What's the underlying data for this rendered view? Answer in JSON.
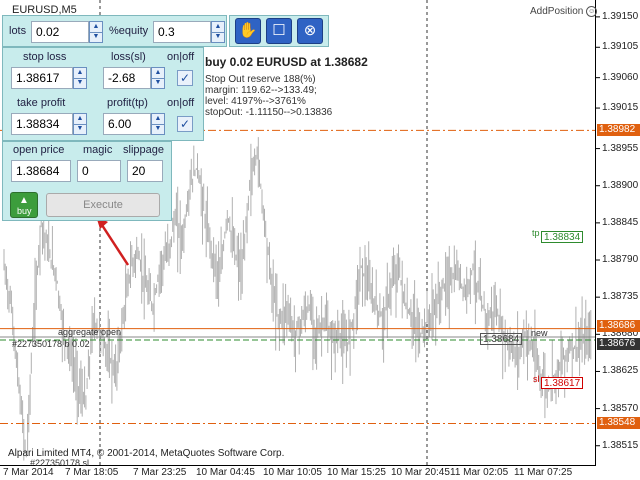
{
  "window": {
    "title": "EURUSD,M5"
  },
  "addposition": {
    "label": "AddPosition",
    "icon": "smiley-icon"
  },
  "panel": {
    "lots": {
      "label": "lots",
      "value": "0.02"
    },
    "equity": {
      "label": "%equity",
      "value": "0.3"
    },
    "toolbar": {
      "hand_icon": "hand-icon",
      "square_icon": "square-icon",
      "close_icon": "close-icon"
    },
    "stop_loss": {
      "label": "stop loss",
      "value": "1.38617"
    },
    "loss_sl": {
      "label": "loss(sl)",
      "value": "-2.68"
    },
    "onoff1": {
      "label": "on|off",
      "checked": true
    },
    "take_profit": {
      "label": "take profit",
      "value": "1.38834"
    },
    "profit_tp": {
      "label": "profit(tp)",
      "value": "6.00"
    },
    "onoff2": {
      "label": "on|off",
      "checked": true
    },
    "open_price": {
      "label": "open price",
      "value": "1.38684"
    },
    "magic": {
      "label": "magic",
      "value": "0"
    },
    "slippage": {
      "label": "slippage",
      "value": "20"
    },
    "buy_label": "buy",
    "execute_label": "Execute"
  },
  "info": {
    "headline": "buy 0.02 EURUSD at 1.38682",
    "line1": "Stop Out reserve 188(%)",
    "line2": "margin: 119.62-->133.49;",
    "line3": "level: 4197%-->3761%",
    "line4": "stopOut: -1.11150-->0.13836"
  },
  "chart_labels": {
    "aggregate": "aggregate open",
    "order_line": "#227350178 b 0.02",
    "sl_order": "#227350178 sl",
    "tp_tag": "tp",
    "tp_value": "1.38834",
    "sl_tag": "sl",
    "sl_value": "1.38617",
    "open_value": "1.38684",
    "new_tag": "new"
  },
  "copyright": "Alpari Limited MT4, © 2001-2014, MetaQuotes Software Corp.",
  "colors": {
    "panel_bg": "#c8ecec",
    "sell_line": "#e05a10",
    "buy_line": "#2e8b2e",
    "sl_box": "#d00000",
    "price": "#b0b0b0"
  },
  "chart_data": {
    "type": "line",
    "symbol": "EURUSD",
    "timeframe": "M5",
    "ylim": [
      1.38485,
      1.39175
    ],
    "yticks": [
      "1.39150",
      "1.39105",
      "1.39060",
      "1.39015",
      "1.38955",
      "1.38900",
      "1.38845",
      "1.38790",
      "1.38735",
      "1.38680",
      "1.38625",
      "1.38570",
      "1.38515"
    ],
    "xticks": [
      "7 Mar 2014",
      "7 Mar 18:05",
      "7 Mar 23:25",
      "10 Mar 04:45",
      "10 Mar 10:05",
      "10 Mar 15:25",
      "10 Mar 20:45",
      "11 Mar 02:05",
      "11 Mar 07:25"
    ],
    "price_tags": [
      {
        "value": "1.38982",
        "color": "#e0600f"
      },
      {
        "value": "1.38686",
        "color": "#e0600f"
      },
      {
        "value": "1.38676",
        "color": "#333333"
      },
      {
        "value": "1.38548",
        "color": "#e0600f"
      }
    ],
    "levels": {
      "take_profit": 1.38834,
      "stop_loss": 1.38617,
      "open": 1.38684,
      "bid": 1.38676,
      "upper_dashdot": 1.38982,
      "lower_dashdot": 1.38548,
      "buy_green": 1.3868
    },
    "series": [
      {
        "x": [
          0,
          1,
          2,
          3,
          4,
          5,
          6,
          7,
          8,
          9,
          10,
          11,
          12,
          13,
          14,
          15,
          16,
          17,
          18,
          19,
          20,
          21,
          22,
          23,
          24,
          25,
          26,
          27,
          28,
          29,
          30,
          31,
          32,
          33,
          34,
          35,
          36,
          37,
          38,
          39,
          40,
          41,
          42,
          43,
          44,
          45,
          46,
          47,
          48,
          49,
          50,
          51,
          52,
          53,
          54,
          55,
          56,
          57,
          58,
          59,
          60,
          61,
          62,
          63,
          64,
          65,
          66,
          67,
          68,
          69,
          70,
          71,
          72,
          73,
          74,
          75,
          76,
          77,
          78,
          79
        ],
        "values": [
          1.3878,
          1.3872,
          1.386,
          1.385,
          1.387,
          1.3885,
          1.388,
          1.3877,
          1.3868,
          1.3865,
          1.386,
          1.3858,
          1.387,
          1.3868,
          1.3865,
          1.3862,
          1.387,
          1.3878,
          1.388,
          1.3875,
          1.3872,
          1.3878,
          1.388,
          1.3885,
          1.3882,
          1.389,
          1.3893,
          1.3885,
          1.388,
          1.3876,
          1.3886,
          1.388,
          1.3877,
          1.389,
          1.3895,
          1.3885,
          1.3875,
          1.387,
          1.3872,
          1.3868,
          1.387,
          1.3872,
          1.3868,
          1.387,
          1.3867,
          1.3868,
          1.3866,
          1.3871,
          1.3878,
          1.3875,
          1.3872,
          1.387,
          1.3875,
          1.3878,
          1.3872,
          1.387,
          1.3868,
          1.387,
          1.3872,
          1.3875,
          1.3876,
          1.3877,
          1.3874,
          1.3878,
          1.3873,
          1.387,
          1.3872,
          1.3868,
          1.3866,
          1.3865,
          1.3868,
          1.3866,
          1.3862,
          1.386,
          1.3862,
          1.3864,
          1.3866,
          1.3866,
          1.3867,
          1.3868
        ]
      }
    ]
  }
}
